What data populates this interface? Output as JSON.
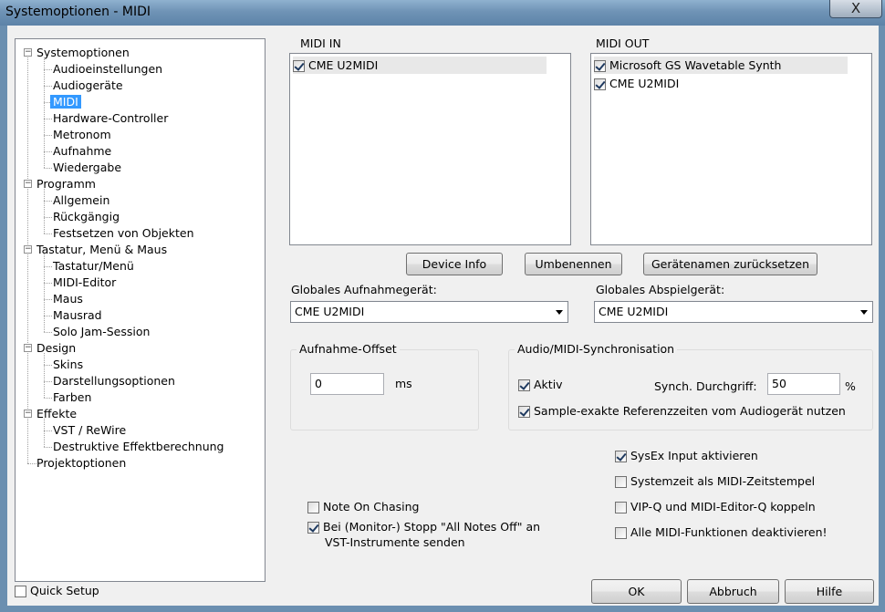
{
  "window": {
    "title": "Systemoptionen - MIDI",
    "close_symbol": "X"
  },
  "tree": {
    "nodes": [
      {
        "label": "Systemoptionen",
        "level": 0,
        "expander": "−"
      },
      {
        "label": "Audioeinstellungen",
        "level": 1
      },
      {
        "label": "Audiogeräte",
        "level": 1
      },
      {
        "label": "MIDI",
        "level": 1,
        "selected": true
      },
      {
        "label": "Hardware-Controller",
        "level": 1
      },
      {
        "label": "Metronom",
        "level": 1
      },
      {
        "label": "Aufnahme",
        "level": 1
      },
      {
        "label": "Wiedergabe",
        "level": 1
      },
      {
        "label": "Programm",
        "level": 0,
        "expander": "−"
      },
      {
        "label": "Allgemein",
        "level": 1
      },
      {
        "label": "Rückgängig",
        "level": 1
      },
      {
        "label": "Festsetzen von Objekten",
        "level": 1
      },
      {
        "label": "Tastatur, Menü & Maus",
        "level": 0,
        "expander": "−"
      },
      {
        "label": "Tastatur/Menü",
        "level": 1
      },
      {
        "label": "MIDI-Editor",
        "level": 1
      },
      {
        "label": "Maus",
        "level": 1
      },
      {
        "label": "Mausrad",
        "level": 1
      },
      {
        "label": "Solo Jam-Session",
        "level": 1
      },
      {
        "label": "Design",
        "level": 0,
        "expander": "−"
      },
      {
        "label": "Skins",
        "level": 1
      },
      {
        "label": "Darstellungsoptionen",
        "level": 1
      },
      {
        "label": "Farben",
        "level": 1
      },
      {
        "label": "Effekte",
        "level": 0,
        "expander": "−"
      },
      {
        "label": "VST / ReWire",
        "level": 1
      },
      {
        "label": "Destruktive Effektberechnung",
        "level": 1
      },
      {
        "label": "Projektoptionen",
        "level": 0
      }
    ]
  },
  "quick_setup": {
    "label": "Quick Setup",
    "checked": false
  },
  "midi_in": {
    "label": "MIDI IN",
    "items": [
      {
        "label": "CME U2MIDI",
        "checked": true
      }
    ]
  },
  "midi_out": {
    "label": "MIDI OUT",
    "items": [
      {
        "label": "Microsoft GS Wavetable Synth",
        "checked": true
      },
      {
        "label": "CME U2MIDI",
        "checked": true
      }
    ]
  },
  "buttons": {
    "device_info": "Device Info",
    "rename": "Umbenennen",
    "reset_names": "Gerätenamen zurücksetzen",
    "ok": "OK",
    "cancel": "Abbruch",
    "help": "Hilfe"
  },
  "global_record": {
    "label": "Globales Aufnahmegerät:",
    "value": "CME U2MIDI"
  },
  "global_play": {
    "label": "Globales Abspielgerät:",
    "value": "CME U2MIDI"
  },
  "record_offset": {
    "label": "Aufnahme-Offset",
    "value": "0",
    "unit": "ms"
  },
  "sync": {
    "label": "Audio/MIDI-Synchronisation",
    "active_label": "Aktiv",
    "active_checked": true,
    "grip_label": "Synch. Durchgriff:",
    "grip_value": "50",
    "grip_unit": "%",
    "sample_label": "Sample-exakte Referenzzeiten vom Audiogerät nutzen",
    "sample_checked": true
  },
  "options": {
    "sysex": {
      "label": "SysEx Input aktivieren",
      "checked": true
    },
    "systemtime": {
      "label": "Systemzeit als MIDI-Zeitstempel",
      "checked": false
    },
    "vipq": {
      "label": "VIP-Q und MIDI-Editor-Q koppeln",
      "checked": false
    },
    "disable_all": {
      "label": "Alle MIDI-Funktionen deaktivieren!",
      "checked": false
    },
    "note_chasing": {
      "label": "Note On Chasing",
      "checked": false
    },
    "all_notes_off_1": "Bei (Monitor-) Stopp \"All Notes Off\" an",
    "all_notes_off_2": "VST-Instrumente senden",
    "all_notes_off_checked": true
  }
}
